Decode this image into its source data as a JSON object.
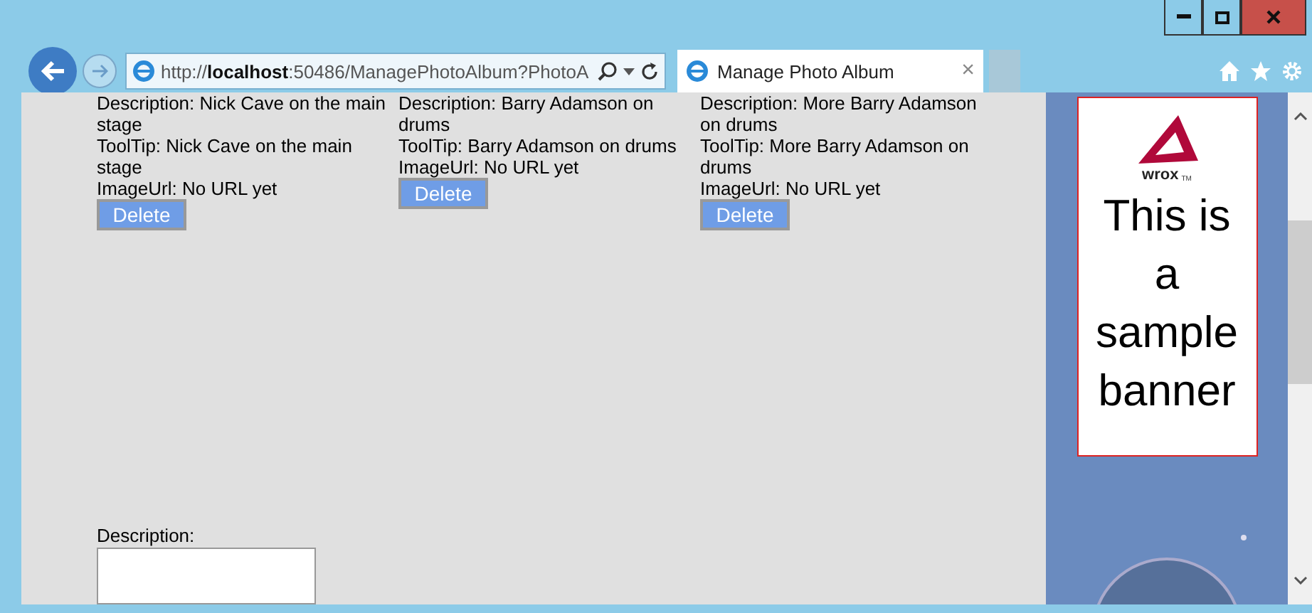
{
  "window": {
    "controls": [
      {
        "kind": "minimize"
      },
      {
        "kind": "maximize"
      },
      {
        "kind": "close"
      }
    ]
  },
  "address_bar": {
    "url": "http://**localhost**:50486/ManagePhotoAlbum?PhotoA"
  },
  "tabs": [
    {
      "title": "Manage Photo Album",
      "close": "×",
      "selected": true
    }
  ],
  "photos": [
    {
      "description": "Description: Nick Cave on the main stage",
      "tooltip": "ToolTip: Nick Cave on the main stage",
      "image_url": "ImageUrl: No URL yet",
      "button": "Delete"
    },
    {
      "description": "Description: Barry Adamson on drums",
      "tooltip": "ToolTip: Barry Adamson on drums",
      "image_url": "ImageUrl: No URL yet",
      "button": "Delete"
    },
    {
      "description": "Description: More Barry Adamson on drums",
      "tooltip": "ToolTip: More Barry Adamson on drums",
      "image_url": "ImageUrl: No URL yet",
      "button": "Delete"
    }
  ],
  "form": {
    "label": "Description:"
  },
  "banner": {
    "brand": "wrox",
    "trademark": "TM",
    "text": "This is a sample banner"
  }
}
